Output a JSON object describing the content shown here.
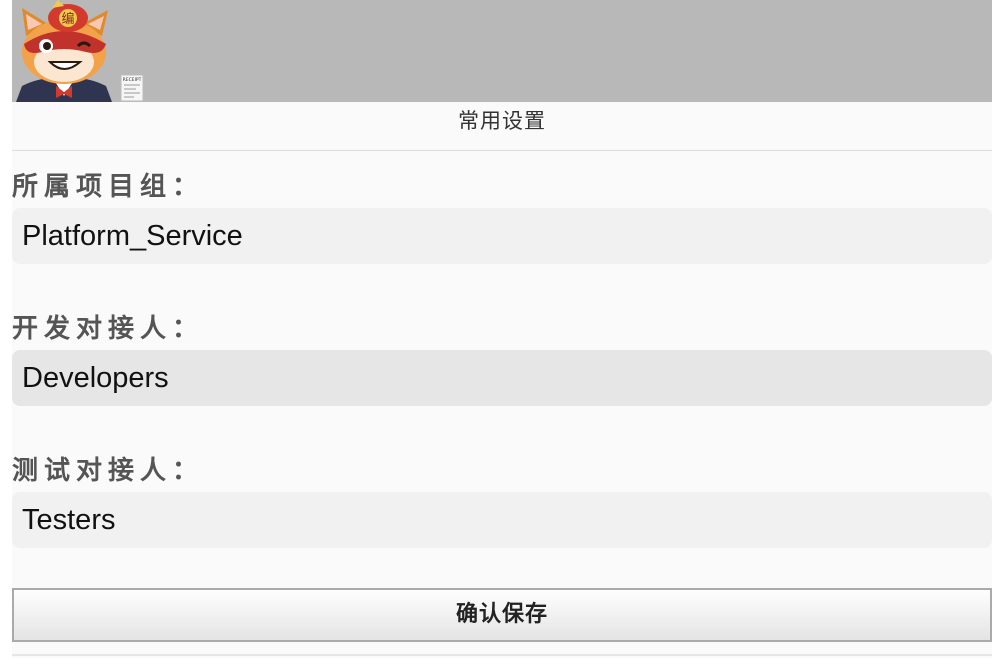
{
  "header": {
    "logo_text": "编",
    "receipt_text": "RECEIPT"
  },
  "panel": {
    "title": "常用设置"
  },
  "fields": [
    {
      "label": "所属项目组：",
      "value": "Platform_Service"
    },
    {
      "label": "开发对接人：",
      "value": "Developers"
    },
    {
      "label": "测试对接人：",
      "value": "Testers"
    }
  ],
  "actions": {
    "save_label": "确认保存"
  },
  "colors": {
    "banner": "#b8b8b8",
    "panel_bg": "#fafafa",
    "input_bg": "#f1f1f1",
    "input_bg_focused": "#e6e6e6",
    "mascot_red": "#c0322b"
  }
}
